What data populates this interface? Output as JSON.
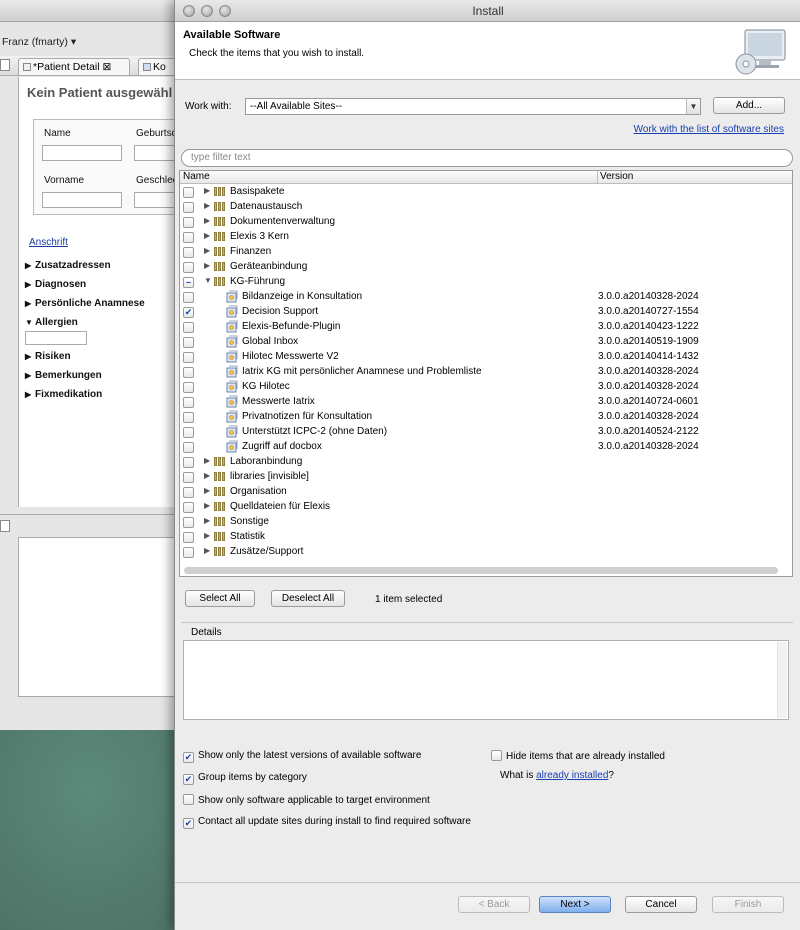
{
  "background_window": {
    "user": "Franz (fmarty) ▾",
    "tabs": [
      {
        "label": "*Patient Detail ⊠"
      },
      {
        "label": "Ko"
      }
    ],
    "heading": "Kein Patient ausgewähl",
    "form": {
      "name_label": "Name",
      "geburt_label": "Geburtsd",
      "vorname_label": "Vorname",
      "geschlecht_label": "Geschlec"
    },
    "anschrift_link": "Anschrift",
    "sections": [
      {
        "label": "Zusatzadressen",
        "expanded": false
      },
      {
        "label": "Diagnosen",
        "expanded": false
      },
      {
        "label": "Persönliche Anamnese",
        "expanded": false
      },
      {
        "label": "Allergien",
        "expanded": true
      },
      {
        "label": "Risiken",
        "expanded": false
      },
      {
        "label": "Bemerkungen",
        "expanded": false
      },
      {
        "label": "Fixmedikation",
        "expanded": false
      }
    ]
  },
  "dialog": {
    "window_title": "Install",
    "header_title": "Available Software",
    "header_description": "Check the items that you wish to install.",
    "work_with_label": "Work with:",
    "work_with_value": "--All Available Sites--",
    "add_button": "Add...",
    "site_list_link": "Work with the list of software sites",
    "filter_placeholder": "type filter text",
    "columns": {
      "name": "Name",
      "version": "Version"
    },
    "tree": [
      {
        "type": "category",
        "label": "Basispakete",
        "expanded": false,
        "check": "none"
      },
      {
        "type": "category",
        "label": "Datenaustausch",
        "expanded": false,
        "check": "none"
      },
      {
        "type": "category",
        "label": "Dokumentenverwaltung",
        "expanded": false,
        "check": "none"
      },
      {
        "type": "category",
        "label": "Elexis 3 Kern",
        "expanded": false,
        "check": "none"
      },
      {
        "type": "category",
        "label": "Finanzen",
        "expanded": false,
        "check": "none"
      },
      {
        "type": "category",
        "label": "Geräteanbindung",
        "expanded": false,
        "check": "none"
      },
      {
        "type": "category",
        "label": "KG-Führung",
        "expanded": true,
        "check": "partial"
      },
      {
        "type": "item",
        "label": "Bildanzeige in Konsultation",
        "version": "3.0.0.a20140328-2024",
        "check": "none"
      },
      {
        "type": "item",
        "label": "Decision Support",
        "version": "3.0.0.a20140727-1554",
        "check": "checked"
      },
      {
        "type": "item",
        "label": "Elexis-Befunde-Plugin",
        "version": "3.0.0.a20140423-1222",
        "check": "none"
      },
      {
        "type": "item",
        "label": "Global Inbox",
        "version": "3.0.0.a20140519-1909",
        "check": "none"
      },
      {
        "type": "item",
        "label": "Hilotec Messwerte V2",
        "version": "3.0.0.a20140414-1432",
        "check": "none"
      },
      {
        "type": "item",
        "label": "Iatrix KG mit persönlicher Anamnese und Problemliste",
        "version": "3.0.0.a20140328-2024",
        "check": "none"
      },
      {
        "type": "item",
        "label": "KG Hilotec",
        "version": "3.0.0.a20140328-2024",
        "check": "none"
      },
      {
        "type": "item",
        "label": "Messwerte Iatrix",
        "version": "3.0.0.a20140724-0601",
        "check": "none"
      },
      {
        "type": "item",
        "label": "Privatnotizen für Konsultation",
        "version": "3.0.0.a20140328-2024",
        "check": "none"
      },
      {
        "type": "item",
        "label": "Unterstützt ICPC-2 (ohne Daten)",
        "version": "3.0.0.a20140524-2122",
        "check": "none"
      },
      {
        "type": "item",
        "label": "Zugriff auf docbox",
        "version": "3.0.0.a20140328-2024",
        "check": "none"
      },
      {
        "type": "category",
        "label": "Laboranbindung",
        "expanded": false,
        "check": "none"
      },
      {
        "type": "category",
        "label": "libraries [invisible]",
        "expanded": false,
        "check": "none"
      },
      {
        "type": "category",
        "label": "Organisation",
        "expanded": false,
        "check": "none"
      },
      {
        "type": "category",
        "label": "Quelldateien für Elexis",
        "expanded": false,
        "check": "none"
      },
      {
        "type": "category",
        "label": "Sonstige",
        "expanded": false,
        "check": "none"
      },
      {
        "type": "category",
        "label": "Statistik",
        "expanded": false,
        "check": "none"
      },
      {
        "type": "category",
        "label": "Zusätze/Support",
        "expanded": false,
        "check": "none"
      }
    ],
    "select_all_button": "Select All",
    "deselect_all_button": "Deselect All",
    "selection_count": "1 item selected",
    "details_label": "Details",
    "options": {
      "latest_versions": {
        "label": "Show only the latest versions of available software",
        "checked": true
      },
      "hide_installed": {
        "label": "Hide items that are already installed",
        "checked": false
      },
      "group_by_category": {
        "label": "Group items by category",
        "checked": true
      },
      "what_is_prefix": "What is ",
      "already_installed_link": "already installed",
      "what_is_suffix": "?",
      "target_env": {
        "label": "Show only software applicable to target environment",
        "checked": false
      },
      "contact_sites": {
        "label": "Contact all update sites during install to find required software",
        "checked": true
      }
    },
    "buttons": {
      "back": "< Back",
      "next": "Next >",
      "cancel": "Cancel",
      "finish": "Finish"
    }
  }
}
